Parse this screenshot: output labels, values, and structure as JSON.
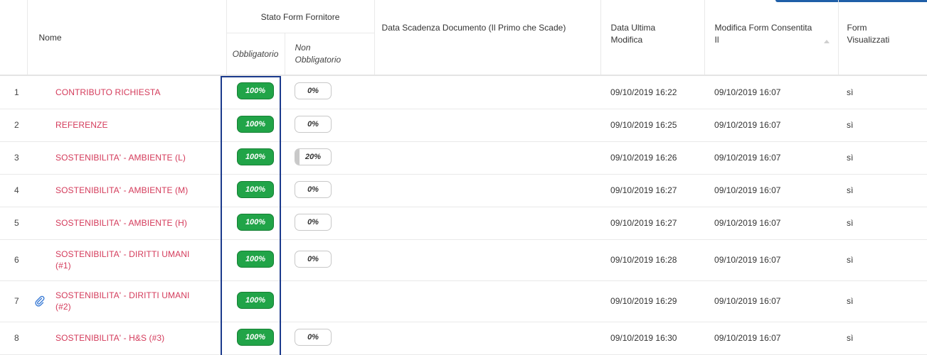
{
  "header": {
    "nome": "Nome",
    "stato_group": "Stato Form Fornitore",
    "obbligatorio": "Obbligatorio",
    "non_obbligatorio_l1": "Non",
    "non_obbligatorio_l2": "Obbligatorio",
    "data_scadenza": "Data Scadenza Documento (Il Primo che Scade)",
    "data_ultima_l1": "Data Ultima",
    "data_ultima_l2": "Modifica",
    "modifica_consentita_l1": "Modifica Form Consentita",
    "modifica_consentita_l2": "Il",
    "form_visualizzati_l1": "Form",
    "form_visualizzati_l2": "Visualizzati"
  },
  "colors": {
    "name_link": "#d43b5b",
    "progress_full": "#21a448",
    "highlight": "#1b3a8c",
    "accent": "#1f5fa8"
  },
  "rows": [
    {
      "num": "1",
      "name_l1": "CONTRIBUTO RICHIESTA",
      "name_l2": "",
      "obb": "100%",
      "non": "0%",
      "non_fill": 0,
      "show_non": true,
      "attach": false,
      "ultima": "09/10/2019 16:22",
      "consentita": "09/10/2019 16:07",
      "visualizzati": "sì"
    },
    {
      "num": "2",
      "name_l1": "REFERENZE",
      "name_l2": "",
      "obb": "100%",
      "non": "0%",
      "non_fill": 0,
      "show_non": true,
      "attach": false,
      "ultima": "09/10/2019 16:25",
      "consentita": "09/10/2019 16:07",
      "visualizzati": "sì"
    },
    {
      "num": "3",
      "name_l1": "SOSTENIBILITA' - AMBIENTE (L)",
      "name_l2": "",
      "obb": "100%",
      "non": "20%",
      "non_fill": 20,
      "show_non": true,
      "attach": false,
      "ultima": "09/10/2019 16:26",
      "consentita": "09/10/2019 16:07",
      "visualizzati": "sì"
    },
    {
      "num": "4",
      "name_l1": "SOSTENIBILITA' - AMBIENTE (M)",
      "name_l2": "",
      "obb": "100%",
      "non": "0%",
      "non_fill": 0,
      "show_non": true,
      "attach": false,
      "ultima": "09/10/2019 16:27",
      "consentita": "09/10/2019 16:07",
      "visualizzati": "sì"
    },
    {
      "num": "5",
      "name_l1": "SOSTENIBILITA' - AMBIENTE (H)",
      "name_l2": "",
      "obb": "100%",
      "non": "0%",
      "non_fill": 0,
      "show_non": true,
      "attach": false,
      "ultima": "09/10/2019 16:27",
      "consentita": "09/10/2019 16:07",
      "visualizzati": "sì"
    },
    {
      "num": "6",
      "name_l1": "SOSTENIBILITA' - DIRITTI UMANI",
      "name_l2": "(#1)",
      "obb": "100%",
      "non": "0%",
      "non_fill": 0,
      "show_non": true,
      "attach": false,
      "ultima": "09/10/2019 16:28",
      "consentita": "09/10/2019 16:07",
      "visualizzati": "sì"
    },
    {
      "num": "7",
      "name_l1": "SOSTENIBILITA' - DIRITTI UMANI",
      "name_l2": "(#2)",
      "obb": "100%",
      "non": "",
      "non_fill": 0,
      "show_non": false,
      "attach": true,
      "attach_icon": "paperclip-icon",
      "ultima": "09/10/2019 16:29",
      "consentita": "09/10/2019 16:07",
      "visualizzati": "sì"
    },
    {
      "num": "8",
      "name_l1": "SOSTENIBILITA' - H&S (#3)",
      "name_l2": "",
      "obb": "100%",
      "non": "0%",
      "non_fill": 0,
      "show_non": true,
      "attach": false,
      "ultima": "09/10/2019 16:30",
      "consentita": "09/10/2019 16:07",
      "visualizzati": "sì"
    }
  ]
}
